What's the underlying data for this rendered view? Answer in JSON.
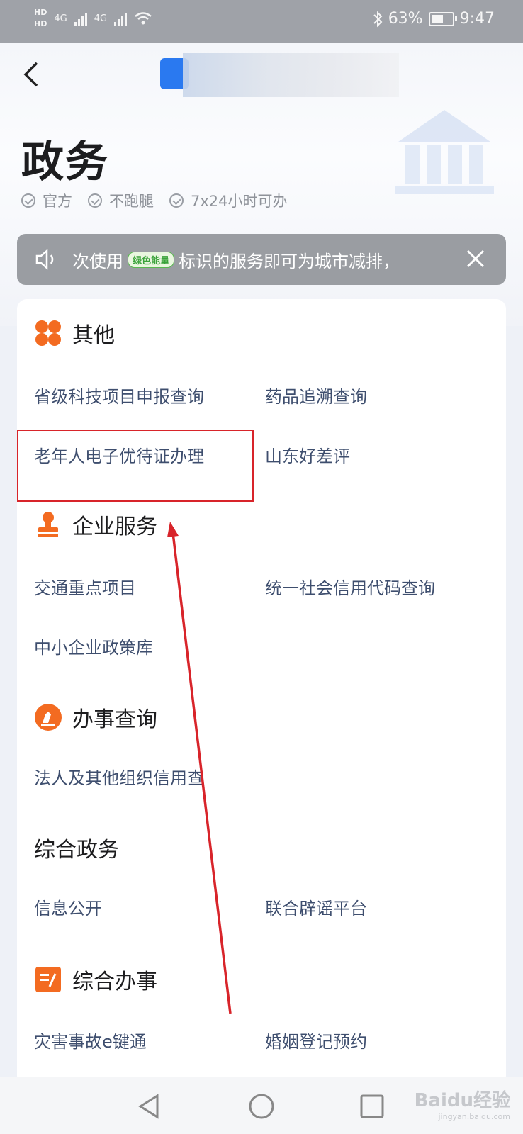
{
  "status_bar": {
    "network_left": "HD",
    "network_left_2": "HD",
    "signal_1": "4G",
    "signal_2": "4G",
    "battery": "63%",
    "battery_level": 0.63,
    "time": "9:47"
  },
  "header": {
    "back_icon": "chevron-left-icon",
    "title": "政务",
    "tags": [
      "官方",
      "不跑腿",
      "7x24小时可办"
    ]
  },
  "notice": {
    "text_prefix": "次使用",
    "badge": "绿色能量",
    "text_suffix": "标识的服务即可为城市减排，",
    "close_icon": "close-icon"
  },
  "sections": [
    {
      "title": "其他",
      "icon": "four-petal-icon",
      "items": [
        "省级科技项目申报查询",
        "药品追溯查询",
        "老年人电子优待证办理",
        "山东好差评"
      ]
    },
    {
      "title": "企业服务",
      "icon": "stamp-icon",
      "items": [
        "交通重点项目",
        "统一社会信用代码查询",
        "中小企业政策库"
      ]
    },
    {
      "title": "办事查询",
      "icon": "search-pen-icon",
      "items": [
        "法人及其他组织信用查"
      ]
    },
    {
      "title": "综合政务",
      "icon": "",
      "items": [
        "信息公开",
        "联合辟谣平台"
      ]
    },
    {
      "title": "综合办事",
      "icon": "document-edit-icon",
      "items": [
        "灾害事故e键通",
        "婚姻登记预约"
      ]
    }
  ],
  "colors": {
    "accent_orange": "#f36b21",
    "item_text": "#3e4e6e",
    "highlight_red": "#d8242a"
  },
  "watermark": {
    "brand": "Baidu经验",
    "url": "jingyan.baidu.com"
  }
}
